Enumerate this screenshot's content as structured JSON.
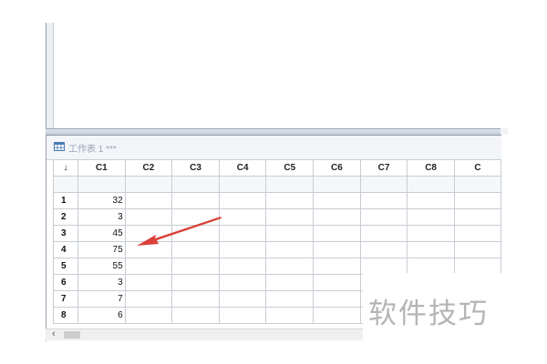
{
  "worksheet": {
    "title": "工作表 1 ***",
    "corner_symbol": "↓",
    "columns": [
      "C1",
      "C2",
      "C3",
      "C4",
      "C5",
      "C6",
      "C7",
      "C8",
      "C"
    ],
    "rows": [
      {
        "row": "1",
        "c1": "32"
      },
      {
        "row": "2",
        "c1": "3"
      },
      {
        "row": "3",
        "c1": "45"
      },
      {
        "row": "4",
        "c1": "75"
      },
      {
        "row": "5",
        "c1": "55"
      },
      {
        "row": "6",
        "c1": "3"
      },
      {
        "row": "7",
        "c1": "7"
      },
      {
        "row": "8",
        "c1": "6"
      }
    ]
  },
  "scrollbar": {
    "left_arrow": "‹"
  },
  "annotation": {
    "color": "#d9413a"
  },
  "watermark": {
    "text": "软件技巧"
  }
}
